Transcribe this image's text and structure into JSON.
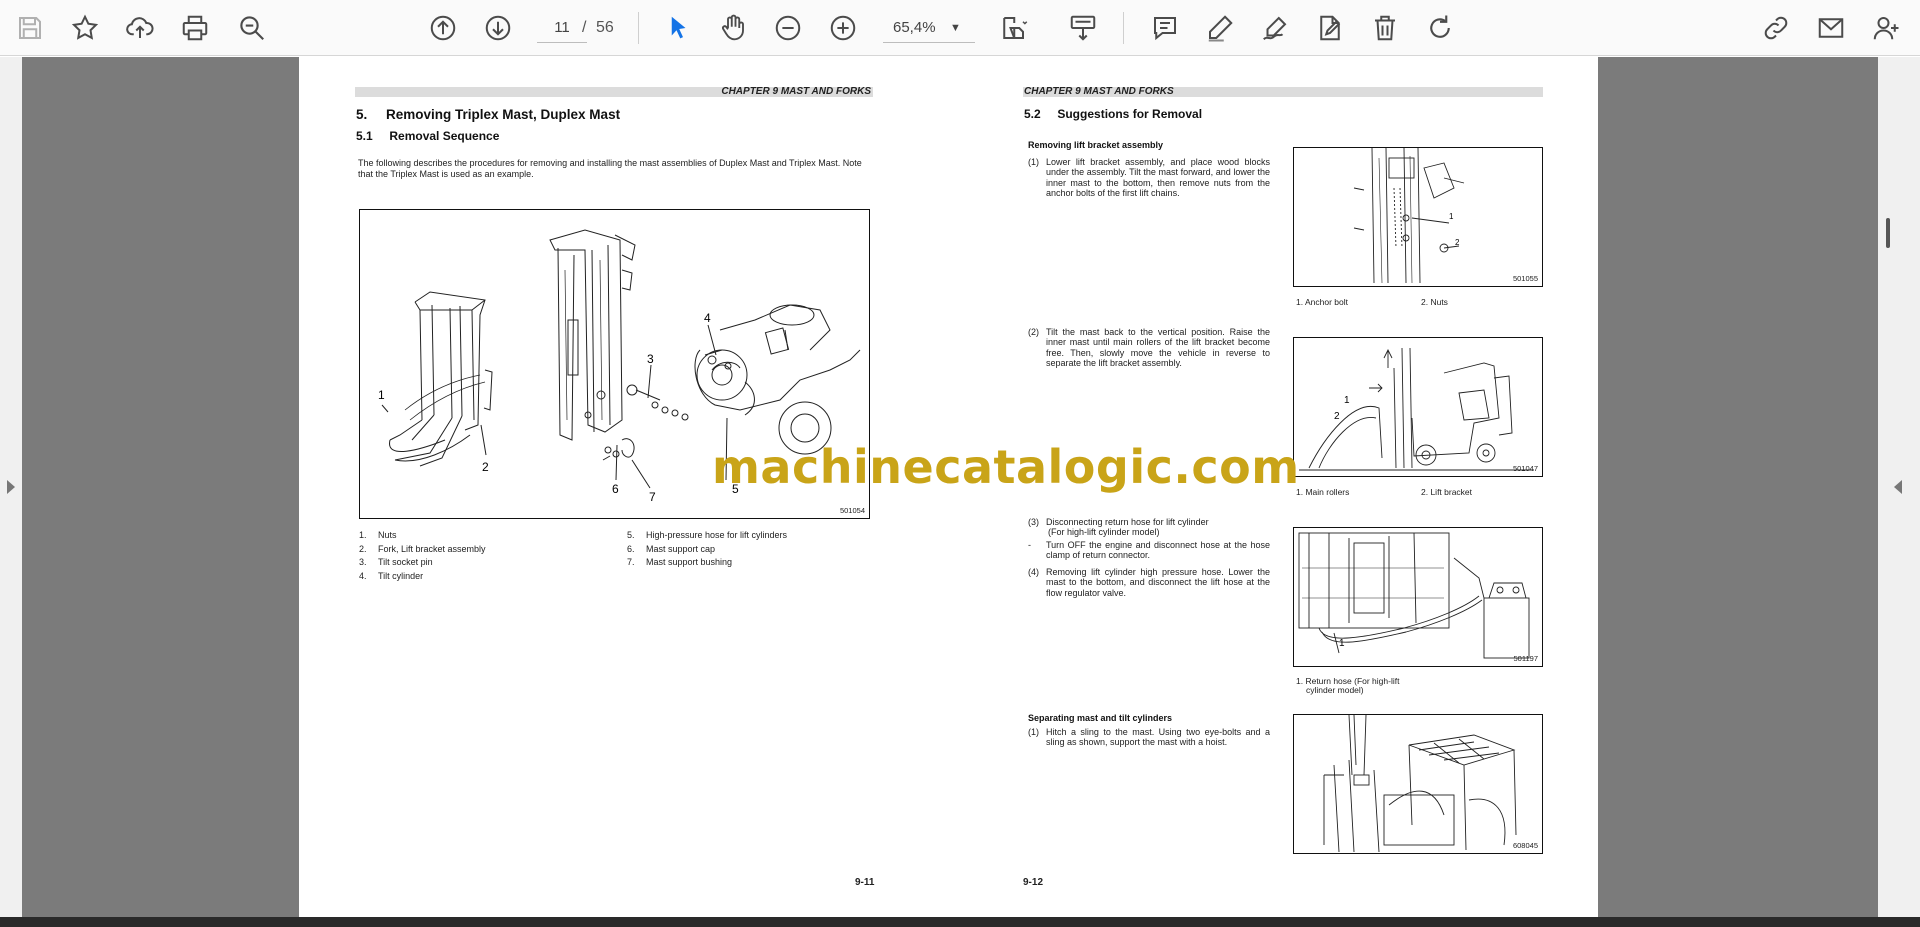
{
  "toolbar": {
    "left_icons": [
      "save-icon",
      "bookmark-star-icon",
      "upload-cloud-icon",
      "print-icon",
      "zoom-out-search-icon"
    ],
    "page_current": "11",
    "page_separator": "/",
    "page_total": "56",
    "zoom_value": "65,4%",
    "right_icons": [
      "share-link-icon",
      "email-icon",
      "add-user-icon"
    ]
  },
  "left_page": {
    "header": "CHAPTER 9 MAST AND FORKS",
    "section_title": "5.     Removing Triplex Mast, Duplex Mast",
    "subsection_title": "5.1     Removal Sequence",
    "intro_line1": "The following describes the procedures for removing and installing the mast assemblies of Duplex Mast and Triplex Mast. Note",
    "intro_line2": "that the Triplex Mast is used as an example.",
    "figure_code": "501054",
    "figure_callouts": [
      "1",
      "2",
      "3",
      "4",
      "5",
      "6",
      "7"
    ],
    "legend_left": [
      {
        "n": "1.",
        "t": "Nuts"
      },
      {
        "n": "2.",
        "t": "Fork, Lift bracket assembly"
      },
      {
        "n": "3.",
        "t": "Tilt socket pin"
      },
      {
        "n": "4.",
        "t": "Tilt cylinder"
      }
    ],
    "legend_right": [
      {
        "n": "5.",
        "t": "High-pressure hose for lift cylinders"
      },
      {
        "n": "6.",
        "t": "Mast support cap"
      },
      {
        "n": "7.",
        "t": "Mast support bushing"
      }
    ],
    "page_number": "9-11"
  },
  "right_page": {
    "header": "CHAPTER 9 MAST AND FORKS",
    "section_title": "5.2     Suggestions for Removal",
    "sub1": "Removing lift bracket assembly",
    "step1_num": "(1)",
    "step1_text": "Lower lift bracket assembly, and place wood blocks under the assembly. Tilt the mast forward, and lower the inner mast to the bottom, then remove nuts from the anchor bolts of the first lift chains.",
    "fig1_code": "501055",
    "fig1_cap_a": "1. Anchor bolt",
    "fig1_cap_b": "2. Nuts",
    "step2_num": "(2)",
    "step2_text": "Tilt the mast back to the vertical position. Raise the inner mast until main rollers of the lift bracket become free. Then, slowly move the vehicle in reverse to separate the lift bracket assembly.",
    "fig2_code": "501047",
    "fig2_cap_a": "1. Main rollers",
    "fig2_cap_b": "2. Lift bracket",
    "step3_num": "(3)",
    "step3_text": "Disconnecting return hose for lift cylinder",
    "step3_text2": "(For high-lift cylinder model)",
    "step3_dash": "-",
    "step3_dash_text": "Turn OFF the engine and disconnect hose at the hose clamp of return connector.",
    "step4_num": "(4)",
    "step4_text": "Removing lift cylinder high pressure hose. Lower the mast to the bottom, and disconnect the lift hose at the flow regulator valve.",
    "fig3_code": "501197",
    "fig3_cap_line1": "1. Return hose (For high-lift",
    "fig3_cap_line2": "cylinder model)",
    "sub2": "Separating mast and tilt cylinders",
    "step5_num": "(1)",
    "step5_text": "Hitch a sling to the mast. Using two eye-bolts and a sling as shown, support the mast with a hoist.",
    "fig4_code": "608045",
    "page_number": "9-12"
  },
  "watermark": "machinecatalogic.com",
  "colors": {
    "accent_blue": "#1473e6",
    "icon_gray": "#4b4b4b",
    "workspace": "#7b7b7b",
    "watermark": "#c9a418"
  }
}
